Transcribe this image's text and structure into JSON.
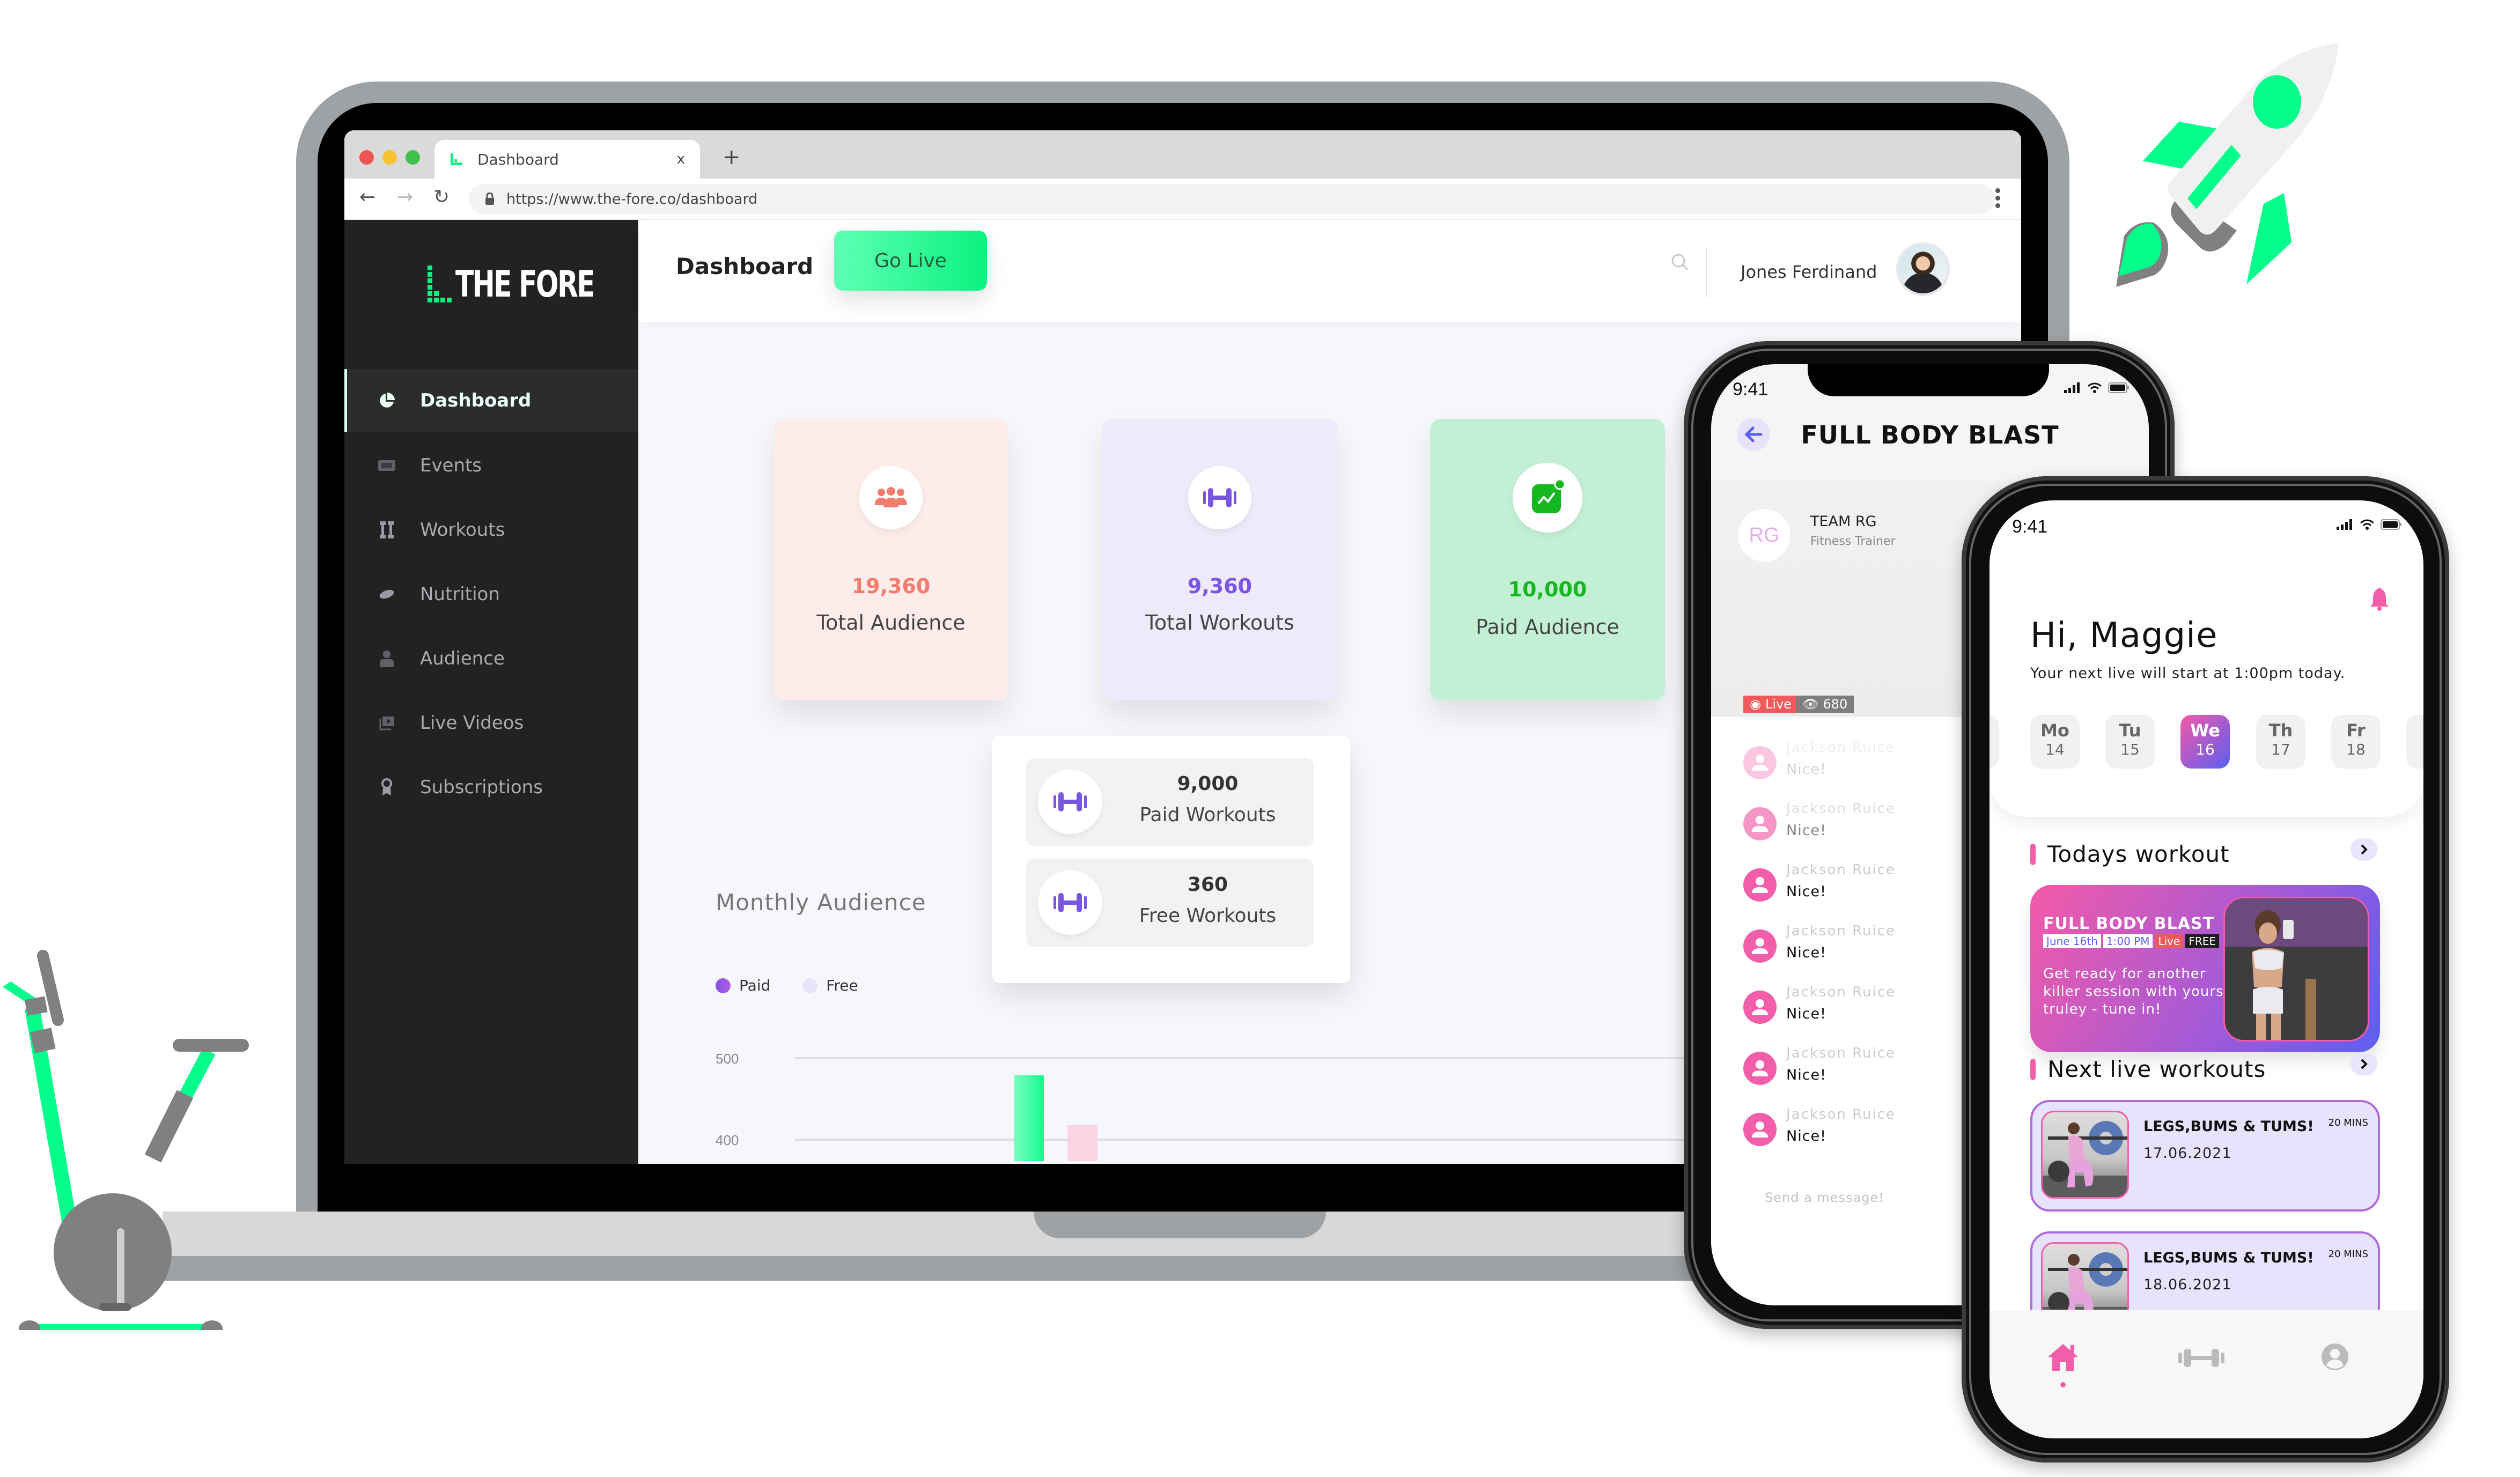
{
  "browser": {
    "tab_title": "Dashboard",
    "tab_close": "x",
    "new_tab": "+",
    "url": "https://www.the-fore.co/dashboard",
    "traffic_colors": [
      "#ed5454",
      "#f6c431",
      "#3fbf4c"
    ]
  },
  "app": {
    "brand": "THE FORE",
    "accent": "#0bf27f",
    "page_title": "Dashboard",
    "go_live_label": "Go Live",
    "user_name": "Jones Ferdinand",
    "sidebar": [
      {
        "label": "Dashboard",
        "icon": "pie-chart-icon",
        "active": true
      },
      {
        "label": "Events",
        "icon": "ticket-icon",
        "active": false
      },
      {
        "label": "Workouts",
        "icon": "dumbbell-icon",
        "active": false
      },
      {
        "label": "Nutrition",
        "icon": "bread-icon",
        "active": false
      },
      {
        "label": "Audience",
        "icon": "person-icon",
        "active": false
      },
      {
        "label": "Live Videos",
        "icon": "video-library-icon",
        "active": false
      },
      {
        "label": "Subscriptions",
        "icon": "award-icon",
        "active": false
      }
    ],
    "stats": [
      {
        "value": "19,360",
        "label": "Total Audience",
        "icon": "group-icon",
        "bg": "#fdece9",
        "color": "#f27c6e"
      },
      {
        "value": "9,360",
        "label": "Total Workouts",
        "icon": "dumbbell-icon",
        "bg": "#eeeaf9",
        "color": "#7a55e0"
      },
      {
        "value": "10,000",
        "label": "Paid Audience",
        "icon": "trend-icon",
        "bg": "#c3f0d5",
        "color": "#15b81e"
      }
    ],
    "workouts": [
      {
        "value": "9,000",
        "label": "Paid Workouts"
      },
      {
        "value": "360",
        "label": "Free Workouts"
      }
    ]
  },
  "chart_data": {
    "type": "bar",
    "title": "Monthly Audience",
    "legend": [
      {
        "name": "Paid",
        "color": "#8a4fe6"
      },
      {
        "name": "Free",
        "color": "#e6e3fb"
      }
    ],
    "y_ticks": [
      500,
      400
    ],
    "ylim": [
      400,
      500
    ],
    "series": [
      {
        "name": "Paid",
        "values": [
          479
        ]
      },
      {
        "name": "Free",
        "values": [
          418
        ]
      }
    ],
    "grid": true,
    "legend_position": "top-left"
  },
  "phone_live": {
    "time": "9:41",
    "title": "FULL BODY BLAST",
    "trainer_logo": "RG",
    "trainer_name": "TEAM RG",
    "trainer_role": "Fitness Trainer",
    "live_label": "Live",
    "viewers": "680",
    "chat": [
      {
        "name": "Jackson Ruice",
        "message": "Nice!"
      },
      {
        "name": "Jackson Ruice",
        "message": "Nice!"
      },
      {
        "name": "Jackson Ruice",
        "message": "Nice!"
      },
      {
        "name": "Jackson Ruice",
        "message": "Nice!"
      },
      {
        "name": "Jackson Ruice",
        "message": "Nice!"
      },
      {
        "name": "Jackson Ruice",
        "message": "Nice!"
      },
      {
        "name": "Jackson Ruice",
        "message": "Nice!"
      }
    ],
    "message_placeholder": "Send a message!"
  },
  "phone_home": {
    "time": "9:41",
    "greeting": "Hi, Maggie",
    "subtitle": "Your next live will start at 1:00pm today.",
    "days": [
      {
        "day": "Mo",
        "date": "14",
        "selected": false
      },
      {
        "day": "Tu",
        "date": "15",
        "selected": false
      },
      {
        "day": "We",
        "date": "16",
        "selected": true
      },
      {
        "day": "Th",
        "date": "17",
        "selected": false
      },
      {
        "day": "Fr",
        "date": "18",
        "selected": false
      }
    ],
    "todays_heading": "Todays workout",
    "todays_workout": {
      "title": "FULL BODY BLAST",
      "date": "June 16th",
      "time": "1:00 PM",
      "live": "Live",
      "price": "FREE",
      "description": "Get ready for another killer session with yours truley - tune in!"
    },
    "next_heading": "Next live workouts",
    "next_workouts": [
      {
        "title": "LEGS,BUMS & TUMS!",
        "duration": "20 MINS",
        "date": "17.06.2021"
      },
      {
        "title": "LEGS,BUMS & TUMS!",
        "duration": "20 MINS",
        "date": "18.06.2021"
      }
    ],
    "bottom_nav": [
      {
        "icon": "home-icon",
        "active": true
      },
      {
        "icon": "dumbbell-icon",
        "active": false
      },
      {
        "icon": "profile-icon",
        "active": false
      }
    ]
  }
}
